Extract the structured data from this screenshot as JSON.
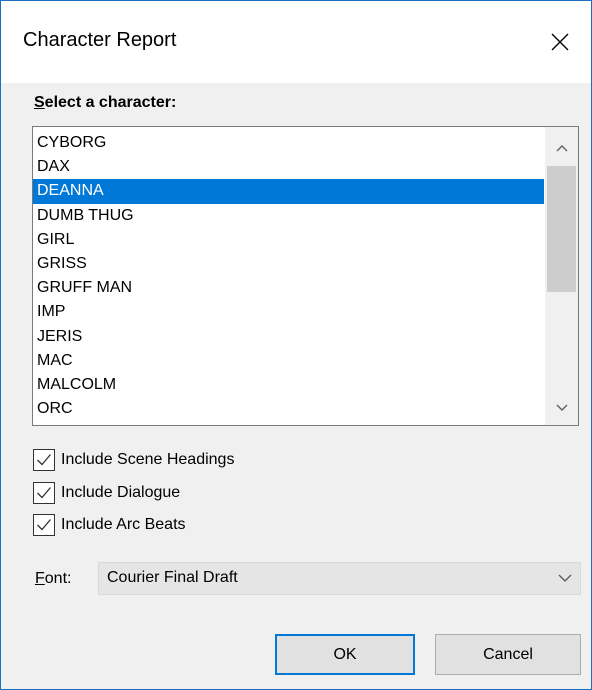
{
  "window": {
    "title": "Character Report"
  },
  "character_list": {
    "label_accel": "S",
    "label_rest": "elect a character:",
    "items": [
      "CYBORG",
      "DAX",
      "DEANNA",
      "DUMB THUG",
      "GIRL",
      "GRISS",
      "GRUFF MAN",
      "IMP",
      "JERIS",
      "MAC",
      "MALCOLM",
      "ORC"
    ],
    "selected": "DEANNA"
  },
  "options": {
    "scene_headings": {
      "label": "Include Scene Headings",
      "checked": true
    },
    "dialogue": {
      "label": "Include Dialogue",
      "checked": true
    },
    "arc_beats": {
      "label": "Include Arc Beats",
      "checked": true
    }
  },
  "font": {
    "label_accel": "F",
    "label_rest": "ont:",
    "value": "Courier Final Draft"
  },
  "buttons": {
    "ok": "OK",
    "cancel": "Cancel"
  },
  "colors": {
    "selection": "#0078d7",
    "window_border": "#1f6fc1",
    "dialog_bg": "#f0f0f0"
  }
}
